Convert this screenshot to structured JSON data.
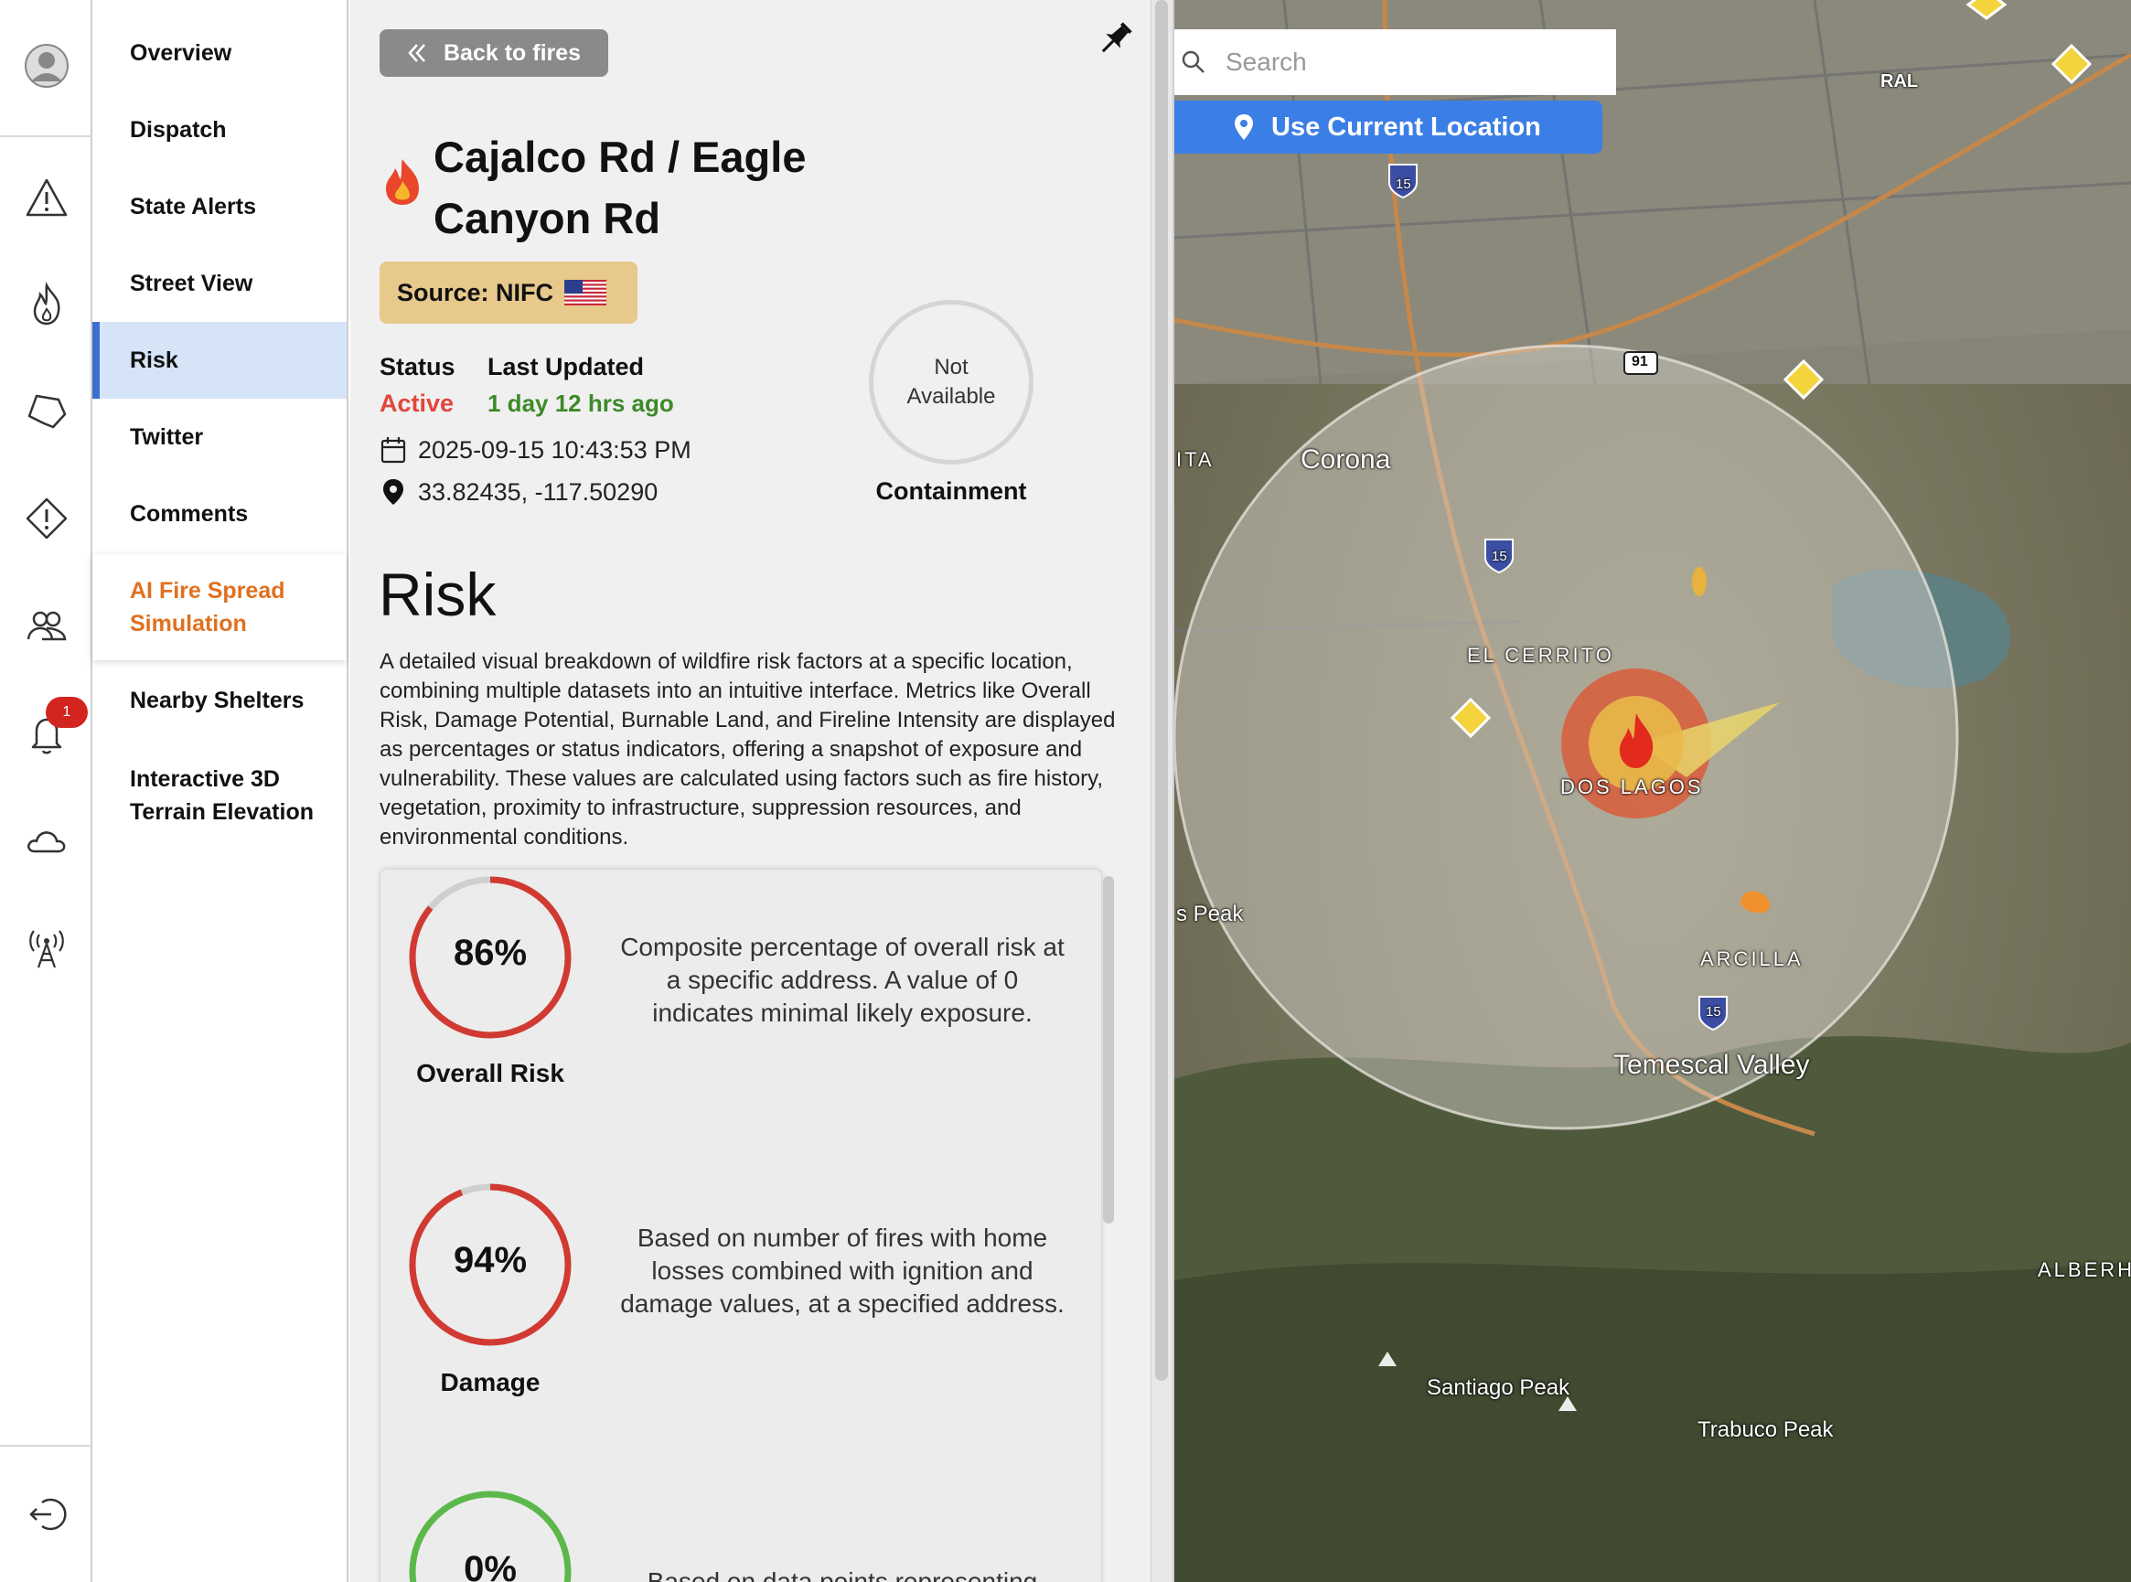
{
  "nav": {
    "items": [
      {
        "label": "Overview"
      },
      {
        "label": "Dispatch"
      },
      {
        "label": "State Alerts"
      },
      {
        "label": "Street View"
      },
      {
        "label": "Risk"
      },
      {
        "label": "Twitter"
      },
      {
        "label": "Comments"
      },
      {
        "label": "AI Fire Spread Simulation"
      },
      {
        "label": "Nearby Shelters"
      },
      {
        "label": "Interactive 3D Terrain Elevation"
      }
    ],
    "active_index": 4,
    "notification_count": "1"
  },
  "rail": {
    "icons": [
      "user-avatar-icon",
      "warning-triangle-icon",
      "fire-icon",
      "perimeter-icon",
      "alert-diamond-icon",
      "community-icon",
      "bell-icon",
      "cloud-icon",
      "tower-icon",
      "logout-icon"
    ]
  },
  "panel": {
    "back_label": "Back to fires",
    "title": "Cajalco Rd / Eagle Canyon Rd",
    "source_label": "Source: NIFC",
    "status_label": "Status",
    "status_value": "Active",
    "updated_label": "Last Updated",
    "updated_value": "1 day 12 hrs ago",
    "datetime": "2025-09-15 10:43:53 PM",
    "coordinates": "33.82435, -117.50290",
    "containment_value": "Not Available",
    "containment_label": "Containment",
    "risk_heading": "Risk",
    "risk_description": "A detailed visual breakdown of wildfire risk factors at a specific location, combining multiple datasets into an intuitive interface. Metrics like Overall Risk, Damage Potential, Burnable Land, and Fireline Intensity are displayed as percentages or status indicators, offering a snapshot of exposure and vulnerability. These values are calculated using factors such as fire history, vegetation, proximity to infrastructure, suppression resources, and environmental conditions."
  },
  "metrics": [
    {
      "value": "86%",
      "percent": 86,
      "name": "Overall Risk",
      "color": "#d13a32",
      "description": "Composite percentage of overall risk at a specific address. A value of 0 indicates minimal likely exposure."
    },
    {
      "value": "94%",
      "percent": 94,
      "name": "Damage",
      "color": "#d13a32",
      "description": "Based on number of fires with home losses combined with ignition and damage values, at a specified address."
    },
    {
      "value": "0%",
      "percent": 0,
      "name": "",
      "color": "#5cb84a",
      "description": "Based on data points representing"
    }
  ],
  "map": {
    "search_placeholder": "Search",
    "use_location_label": "Use Current Location",
    "labels": [
      "Corona",
      "EL CERRITO",
      "DOS LAGOS",
      "ARCILLA",
      "Temescal Valley",
      "Santiago Peak",
      "Trabuco Peak",
      "ALBERH",
      "ITA",
      "s Peak",
      "RAL"
    ],
    "highway_shields": [
      "15",
      "91"
    ]
  },
  "colors": {
    "accent_blue": "#3b7ee6",
    "active_red": "#e2453c",
    "updated_green": "#3c8a28",
    "nav_orange": "#e07020",
    "source_badge": "#e6c98b"
  }
}
